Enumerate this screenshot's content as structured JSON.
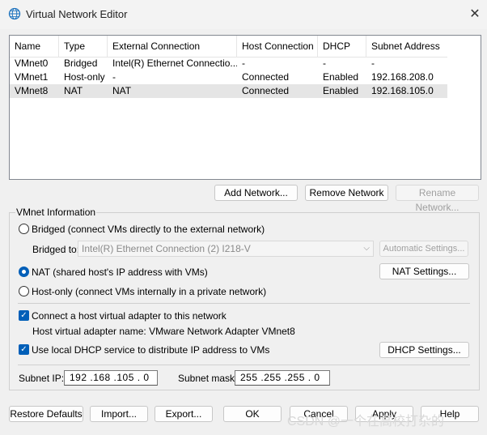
{
  "window": {
    "title": "Virtual Network Editor",
    "close_glyph": "✕"
  },
  "table": {
    "headers": [
      "Name",
      "Type",
      "External Connection",
      "Host Connection",
      "DHCP",
      "Subnet Address"
    ],
    "rows": [
      [
        "VMnet0",
        "Bridged",
        "Intel(R) Ethernet Connectio...",
        "-",
        "-",
        "-"
      ],
      [
        "VMnet1",
        "Host-only",
        "-",
        "Connected",
        "Enabled",
        "192.168.208.0"
      ],
      [
        "VMnet8",
        "NAT",
        "NAT",
        "Connected",
        "Enabled",
        "192.168.105.0"
      ]
    ],
    "selected_row": 2
  },
  "net_buttons": {
    "add": "Add Network...",
    "remove": "Remove Network",
    "rename": "Rename Network..."
  },
  "vmnet_info": {
    "legend": "VMnet Information",
    "bridged_label": "Bridged (connect VMs directly to the external network)",
    "bridged_to_label": "Bridged to:",
    "bridged_to_value": "Intel(R) Ethernet Connection (2) I218-V",
    "auto_settings": "Automatic Settings...",
    "nat_label": "NAT (shared host's IP address with VMs)",
    "nat_settings": "NAT Settings...",
    "hostonly_label": "Host-only (connect VMs internally in a private network)",
    "selected_mode": "nat",
    "connect_adapter_label": "Connect a host virtual adapter to this network",
    "connect_adapter_checked": true,
    "adapter_name_label": "Host virtual adapter name: VMware Network Adapter VMnet8",
    "dhcp_label": "Use local DHCP service to distribute IP address to VMs",
    "dhcp_checked": true,
    "dhcp_settings": "DHCP Settings...",
    "subnet_ip_label": "Subnet IP:",
    "subnet_ip": "192 .168 .105 . 0",
    "subnet_mask_label": "Subnet mask:",
    "subnet_mask": "255 .255 .255 . 0"
  },
  "bottom_buttons": {
    "restore": "Restore Defaults",
    "import": "Import...",
    "export": "Export...",
    "ok": "OK",
    "cancel": "Cancel",
    "apply": "Apply",
    "help": "Help"
  },
  "watermark": "CSDN @一个在高校打杂的",
  "colors": {
    "accent": "#005fb8",
    "selected_row": "#e5e5e5",
    "background": "#f0f0f0"
  }
}
